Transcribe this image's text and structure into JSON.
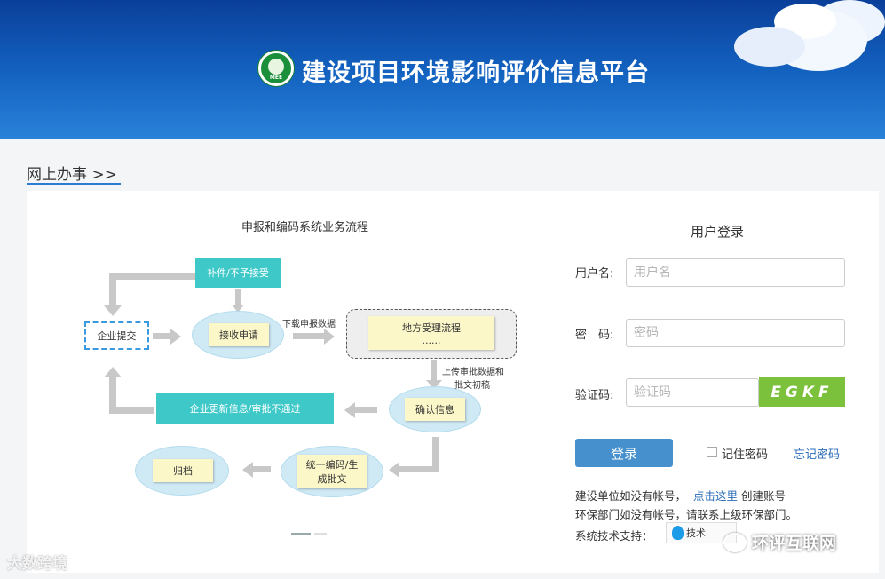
{
  "header": {
    "site_title": "建设项目环境影响评价信息平台",
    "logo_text": "MEE",
    "colors": {
      "banner_top": "#0a3f9a",
      "banner_bottom": "#2a82d8"
    }
  },
  "section": {
    "title": "网上办事 >>"
  },
  "flowchart": {
    "title": "申报和编码系统业务流程",
    "nodes": {
      "supplement": "补件/不予接受",
      "company_submit": "企业提交",
      "receive": "接收申请",
      "download_label": "下载申报数据",
      "local_process": "地方受理流程",
      "local_process_sub": "......",
      "upload_label_1": "上传审批数据和",
      "upload_label_2": "批文初稿",
      "confirm": "确认信息",
      "update": "企业更新信息/审批不通过",
      "encode_1": "统一编码/生",
      "encode_2": "成批文",
      "archive": "归档"
    }
  },
  "login": {
    "title": "用户登录",
    "username_label": "用户名:",
    "username_placeholder": "用户名",
    "password_label": "密　码:",
    "password_placeholder": "密码",
    "captcha_label": "验证码:",
    "captcha_placeholder": "验证码",
    "captcha_value": "EGKF",
    "login_button": "登录",
    "remember_label": "记住密码",
    "forgot_label": "忘记密码",
    "info_line1_pre": "建设单位如没有帐号，",
    "info_line1_link": "点击这里",
    "info_line1_post": "创建账号",
    "info_line2": "环保部门如没有帐号，请联系上级环保部门。",
    "support_label": "系统技术支持：",
    "support_chip": "技术",
    "accent_color": "#4691cd",
    "captcha_color": "#7bc13c"
  },
  "watermarks": {
    "left": "大数跨境",
    "right": "环评互联网"
  }
}
